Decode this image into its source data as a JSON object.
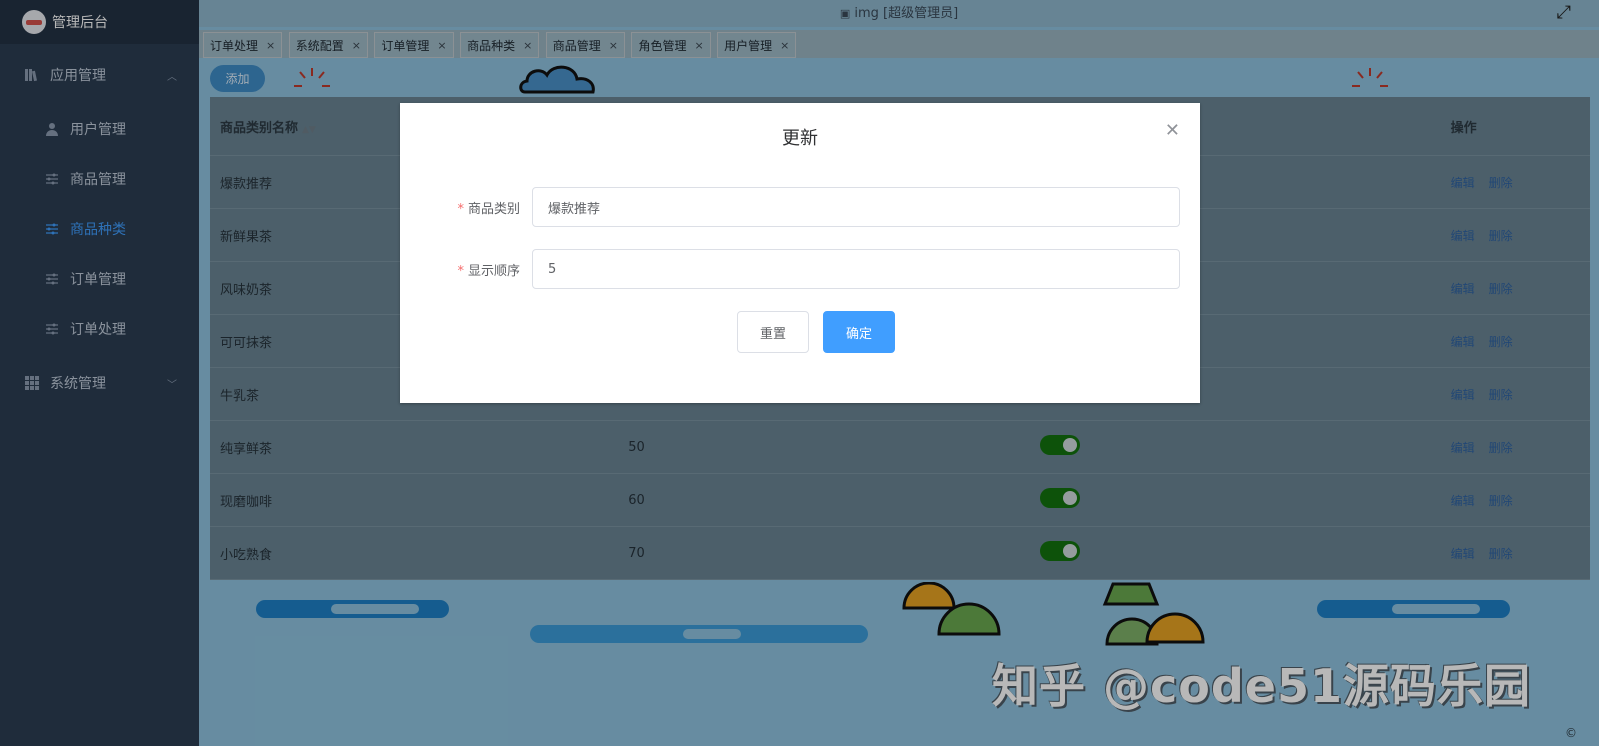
{
  "app": {
    "title": "管理后台"
  },
  "header": {
    "center_text": "img [超级管理员]",
    "fullscreen_icon": "expand-icon"
  },
  "sidebar": {
    "groups": [
      {
        "label": "应用管理",
        "icon": "bookshelf-icon",
        "items": [
          {
            "label": "用户管理",
            "icon": "user-icon"
          },
          {
            "label": "商品管理",
            "icon": "sliders-icon"
          },
          {
            "label": "商品种类",
            "icon": "sliders-icon",
            "active": true
          },
          {
            "label": "订单管理",
            "icon": "sliders-icon"
          },
          {
            "label": "订单处理",
            "icon": "sliders-icon"
          }
        ]
      },
      {
        "label": "系统管理",
        "icon": "grid-icon",
        "items": []
      }
    ]
  },
  "tabs": [
    {
      "label": "订单处理"
    },
    {
      "label": "系统配置"
    },
    {
      "label": "订单管理"
    },
    {
      "label": "商品种类"
    },
    {
      "label": "商品管理"
    },
    {
      "label": "角色管理"
    },
    {
      "label": "用户管理"
    }
  ],
  "toolbar": {
    "add_label": "添加"
  },
  "table": {
    "headers": {
      "name": "商品类别名称",
      "actions": "操作"
    },
    "edit_label": "编辑",
    "delete_label": "删除",
    "rows": [
      {
        "name": "爆款推荐",
        "order": "",
        "enabled": true
      },
      {
        "name": "新鲜果茶",
        "order": "",
        "enabled": true
      },
      {
        "name": "风味奶茶",
        "order": "",
        "enabled": true
      },
      {
        "name": "可可抹茶",
        "order": "",
        "enabled": true
      },
      {
        "name": "牛乳茶",
        "order": "",
        "enabled": true
      },
      {
        "name": "纯享鲜茶",
        "order": "50",
        "enabled": true
      },
      {
        "name": "现磨咖啡",
        "order": "60",
        "enabled": true
      },
      {
        "name": "小吃熟食",
        "order": "70",
        "enabled": true
      }
    ]
  },
  "dialog": {
    "title": "更新",
    "fields": [
      {
        "label": "商品类别",
        "value": "爆款推荐",
        "required": true
      },
      {
        "label": "显示顺序",
        "value": "5",
        "required": true
      }
    ],
    "reset_label": "重置",
    "confirm_label": "确定"
  },
  "watermark": "知乎 @code51源码乐园",
  "copyright": "©",
  "colors": {
    "primary": "#409eff",
    "sidebar_bg": "#304156",
    "switch_on": "#13ce66",
    "required": "#f56c6c"
  }
}
